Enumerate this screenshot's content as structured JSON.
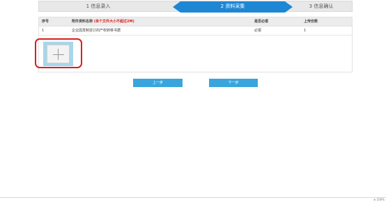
{
  "steps": {
    "step1": "1 信息录入",
    "step2": "2 资料采集",
    "step3": "3 信息确认",
    "active": 2
  },
  "table": {
    "headers": {
      "index": "序号",
      "name": "附件资料名称",
      "name_hint": "(单个文件大小不超过2M)",
      "required": "是否必报",
      "count": "上传份数"
    },
    "rows": [
      {
        "index": "1",
        "name": "企业因发制造订的产权转移书据",
        "required": "必报",
        "count": "1"
      }
    ]
  },
  "upload": {
    "icon": "plus-icon"
  },
  "buttons": {
    "prev": "上一步",
    "next": "下一步"
  },
  "footer": {
    "zoom": "⊕ 100%"
  },
  "colors": {
    "active_step": "#1e87d4",
    "button": "#3aa5dc",
    "highlight_outline": "#d81e1e",
    "upload_frame": "#a8d6ea",
    "hint_text": "#e02020"
  }
}
